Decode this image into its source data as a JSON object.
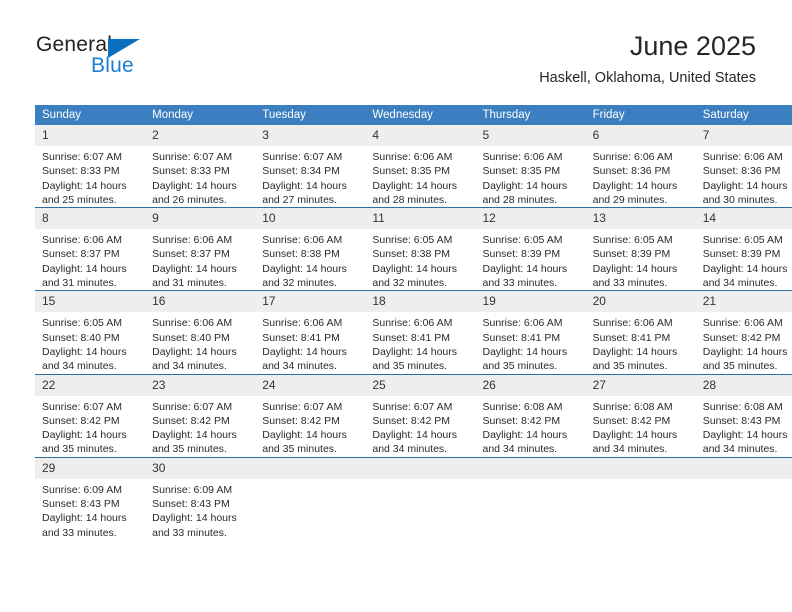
{
  "brand": {
    "name_top": "General",
    "name_bottom": "Blue",
    "color_blue": "#1b7fd4",
    "color_triangle": "#0b6fc0"
  },
  "header": {
    "title": "June 2025",
    "subtitle": "Haskell, Oklahoma, United States"
  },
  "theme": {
    "header_bg": "#3c7fc0",
    "header_text": "#ffffff",
    "daynum_bg": "#eeeeee",
    "row_divider": "#2e6da4"
  },
  "calendar": {
    "weekday_headers": [
      "Sunday",
      "Monday",
      "Tuesday",
      "Wednesday",
      "Thursday",
      "Friday",
      "Saturday"
    ],
    "labels": {
      "sunrise": "Sunrise:",
      "sunset": "Sunset:",
      "daylight": "Daylight:"
    },
    "weeks": [
      [
        {
          "day": "1",
          "sunrise": "Sunrise: 6:07 AM",
          "sunset": "Sunset: 8:33 PM",
          "daylight_1": "Daylight: 14 hours",
          "daylight_2": "and 25 minutes."
        },
        {
          "day": "2",
          "sunrise": "Sunrise: 6:07 AM",
          "sunset": "Sunset: 8:33 PM",
          "daylight_1": "Daylight: 14 hours",
          "daylight_2": "and 26 minutes."
        },
        {
          "day": "3",
          "sunrise": "Sunrise: 6:07 AM",
          "sunset": "Sunset: 8:34 PM",
          "daylight_1": "Daylight: 14 hours",
          "daylight_2": "and 27 minutes."
        },
        {
          "day": "4",
          "sunrise": "Sunrise: 6:06 AM",
          "sunset": "Sunset: 8:35 PM",
          "daylight_1": "Daylight: 14 hours",
          "daylight_2": "and 28 minutes."
        },
        {
          "day": "5",
          "sunrise": "Sunrise: 6:06 AM",
          "sunset": "Sunset: 8:35 PM",
          "daylight_1": "Daylight: 14 hours",
          "daylight_2": "and 28 minutes."
        },
        {
          "day": "6",
          "sunrise": "Sunrise: 6:06 AM",
          "sunset": "Sunset: 8:36 PM",
          "daylight_1": "Daylight: 14 hours",
          "daylight_2": "and 29 minutes."
        },
        {
          "day": "7",
          "sunrise": "Sunrise: 6:06 AM",
          "sunset": "Sunset: 8:36 PM",
          "daylight_1": "Daylight: 14 hours",
          "daylight_2": "and 30 minutes."
        }
      ],
      [
        {
          "day": "8",
          "sunrise": "Sunrise: 6:06 AM",
          "sunset": "Sunset: 8:37 PM",
          "daylight_1": "Daylight: 14 hours",
          "daylight_2": "and 31 minutes."
        },
        {
          "day": "9",
          "sunrise": "Sunrise: 6:06 AM",
          "sunset": "Sunset: 8:37 PM",
          "daylight_1": "Daylight: 14 hours",
          "daylight_2": "and 31 minutes."
        },
        {
          "day": "10",
          "sunrise": "Sunrise: 6:06 AM",
          "sunset": "Sunset: 8:38 PM",
          "daylight_1": "Daylight: 14 hours",
          "daylight_2": "and 32 minutes."
        },
        {
          "day": "11",
          "sunrise": "Sunrise: 6:05 AM",
          "sunset": "Sunset: 8:38 PM",
          "daylight_1": "Daylight: 14 hours",
          "daylight_2": "and 32 minutes."
        },
        {
          "day": "12",
          "sunrise": "Sunrise: 6:05 AM",
          "sunset": "Sunset: 8:39 PM",
          "daylight_1": "Daylight: 14 hours",
          "daylight_2": "and 33 minutes."
        },
        {
          "day": "13",
          "sunrise": "Sunrise: 6:05 AM",
          "sunset": "Sunset: 8:39 PM",
          "daylight_1": "Daylight: 14 hours",
          "daylight_2": "and 33 minutes."
        },
        {
          "day": "14",
          "sunrise": "Sunrise: 6:05 AM",
          "sunset": "Sunset: 8:39 PM",
          "daylight_1": "Daylight: 14 hours",
          "daylight_2": "and 34 minutes."
        }
      ],
      [
        {
          "day": "15",
          "sunrise": "Sunrise: 6:05 AM",
          "sunset": "Sunset: 8:40 PM",
          "daylight_1": "Daylight: 14 hours",
          "daylight_2": "and 34 minutes."
        },
        {
          "day": "16",
          "sunrise": "Sunrise: 6:06 AM",
          "sunset": "Sunset: 8:40 PM",
          "daylight_1": "Daylight: 14 hours",
          "daylight_2": "and 34 minutes."
        },
        {
          "day": "17",
          "sunrise": "Sunrise: 6:06 AM",
          "sunset": "Sunset: 8:41 PM",
          "daylight_1": "Daylight: 14 hours",
          "daylight_2": "and 34 minutes."
        },
        {
          "day": "18",
          "sunrise": "Sunrise: 6:06 AM",
          "sunset": "Sunset: 8:41 PM",
          "daylight_1": "Daylight: 14 hours",
          "daylight_2": "and 35 minutes."
        },
        {
          "day": "19",
          "sunrise": "Sunrise: 6:06 AM",
          "sunset": "Sunset: 8:41 PM",
          "daylight_1": "Daylight: 14 hours",
          "daylight_2": "and 35 minutes."
        },
        {
          "day": "20",
          "sunrise": "Sunrise: 6:06 AM",
          "sunset": "Sunset: 8:41 PM",
          "daylight_1": "Daylight: 14 hours",
          "daylight_2": "and 35 minutes."
        },
        {
          "day": "21",
          "sunrise": "Sunrise: 6:06 AM",
          "sunset": "Sunset: 8:42 PM",
          "daylight_1": "Daylight: 14 hours",
          "daylight_2": "and 35 minutes."
        }
      ],
      [
        {
          "day": "22",
          "sunrise": "Sunrise: 6:07 AM",
          "sunset": "Sunset: 8:42 PM",
          "daylight_1": "Daylight: 14 hours",
          "daylight_2": "and 35 minutes."
        },
        {
          "day": "23",
          "sunrise": "Sunrise: 6:07 AM",
          "sunset": "Sunset: 8:42 PM",
          "daylight_1": "Daylight: 14 hours",
          "daylight_2": "and 35 minutes."
        },
        {
          "day": "24",
          "sunrise": "Sunrise: 6:07 AM",
          "sunset": "Sunset: 8:42 PM",
          "daylight_1": "Daylight: 14 hours",
          "daylight_2": "and 35 minutes."
        },
        {
          "day": "25",
          "sunrise": "Sunrise: 6:07 AM",
          "sunset": "Sunset: 8:42 PM",
          "daylight_1": "Daylight: 14 hours",
          "daylight_2": "and 34 minutes."
        },
        {
          "day": "26",
          "sunrise": "Sunrise: 6:08 AM",
          "sunset": "Sunset: 8:42 PM",
          "daylight_1": "Daylight: 14 hours",
          "daylight_2": "and 34 minutes."
        },
        {
          "day": "27",
          "sunrise": "Sunrise: 6:08 AM",
          "sunset": "Sunset: 8:42 PM",
          "daylight_1": "Daylight: 14 hours",
          "daylight_2": "and 34 minutes."
        },
        {
          "day": "28",
          "sunrise": "Sunrise: 6:08 AM",
          "sunset": "Sunset: 8:43 PM",
          "daylight_1": "Daylight: 14 hours",
          "daylight_2": "and 34 minutes."
        }
      ],
      [
        {
          "day": "29",
          "sunrise": "Sunrise: 6:09 AM",
          "sunset": "Sunset: 8:43 PM",
          "daylight_1": "Daylight: 14 hours",
          "daylight_2": "and 33 minutes."
        },
        {
          "day": "30",
          "sunrise": "Sunrise: 6:09 AM",
          "sunset": "Sunset: 8:43 PM",
          "daylight_1": "Daylight: 14 hours",
          "daylight_2": "and 33 minutes."
        },
        {
          "day": "",
          "sunrise": "",
          "sunset": "",
          "daylight_1": "",
          "daylight_2": ""
        },
        {
          "day": "",
          "sunrise": "",
          "sunset": "",
          "daylight_1": "",
          "daylight_2": ""
        },
        {
          "day": "",
          "sunrise": "",
          "sunset": "",
          "daylight_1": "",
          "daylight_2": ""
        },
        {
          "day": "",
          "sunrise": "",
          "sunset": "",
          "daylight_1": "",
          "daylight_2": ""
        },
        {
          "day": "",
          "sunrise": "",
          "sunset": "",
          "daylight_1": "",
          "daylight_2": ""
        }
      ]
    ]
  }
}
